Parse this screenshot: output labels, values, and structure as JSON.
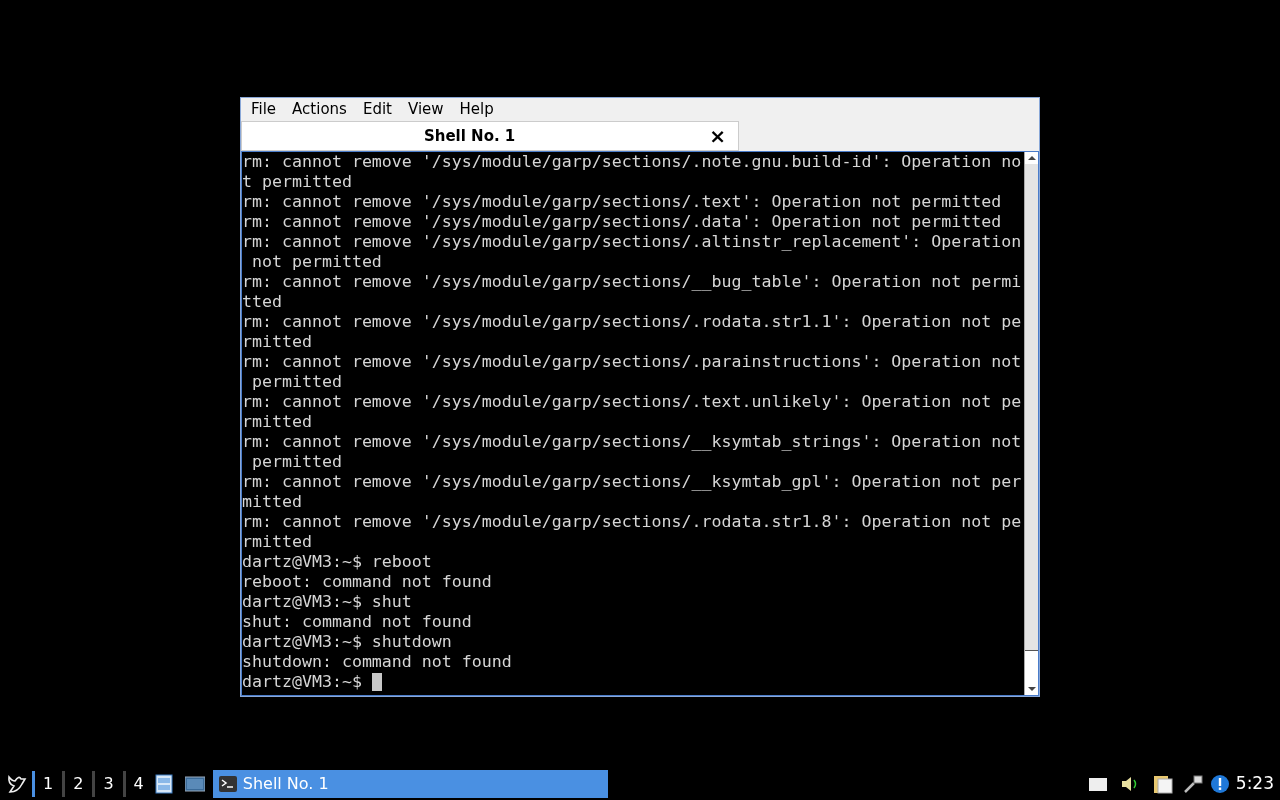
{
  "window": {
    "menu": [
      "File",
      "Actions",
      "Edit",
      "View",
      "Help"
    ],
    "tabs": [
      {
        "label": "Shell No. 1",
        "selected": true,
        "close": "×"
      }
    ],
    "terminal": {
      "lines": [
        "rm: cannot remove '/sys/module/garp/sections/.note.gnu.build-id': Operation no",
        "t permitted",
        "rm: cannot remove '/sys/module/garp/sections/.text': Operation not permitted",
        "rm: cannot remove '/sys/module/garp/sections/.data': Operation not permitted",
        "rm: cannot remove '/sys/module/garp/sections/.altinstr_replacement': Operation",
        " not permitted",
        "rm: cannot remove '/sys/module/garp/sections/__bug_table': Operation not permi",
        "tted",
        "rm: cannot remove '/sys/module/garp/sections/.rodata.str1.1': Operation not pe",
        "rmitted",
        "rm: cannot remove '/sys/module/garp/sections/.parainstructions': Operation not",
        " permitted",
        "rm: cannot remove '/sys/module/garp/sections/.text.unlikely': Operation not pe",
        "rmitted",
        "rm: cannot remove '/sys/module/garp/sections/__ksymtab_strings': Operation not",
        " permitted",
        "rm: cannot remove '/sys/module/garp/sections/__ksymtab_gpl': Operation not per",
        "mitted",
        "rm: cannot remove '/sys/module/garp/sections/.rodata.str1.8': Operation not pe",
        "rmitted",
        "dartz@VM3:~$ reboot",
        "reboot: command not found",
        "dartz@VM3:~$ shut",
        "shut: command not found",
        "dartz@VM3:~$ shutdown",
        "shutdown: command not found"
      ],
      "prompt": "dartz@VM3:~$ "
    }
  },
  "taskbar": {
    "workspaces": [
      {
        "label": "1",
        "selected": true
      },
      {
        "label": "2",
        "selected": false
      },
      {
        "label": "3",
        "selected": false
      },
      {
        "label": "4",
        "selected": false
      }
    ],
    "tasks": [
      {
        "label": "Shell No. 1",
        "selected": true
      }
    ],
    "clock": "5:23"
  }
}
